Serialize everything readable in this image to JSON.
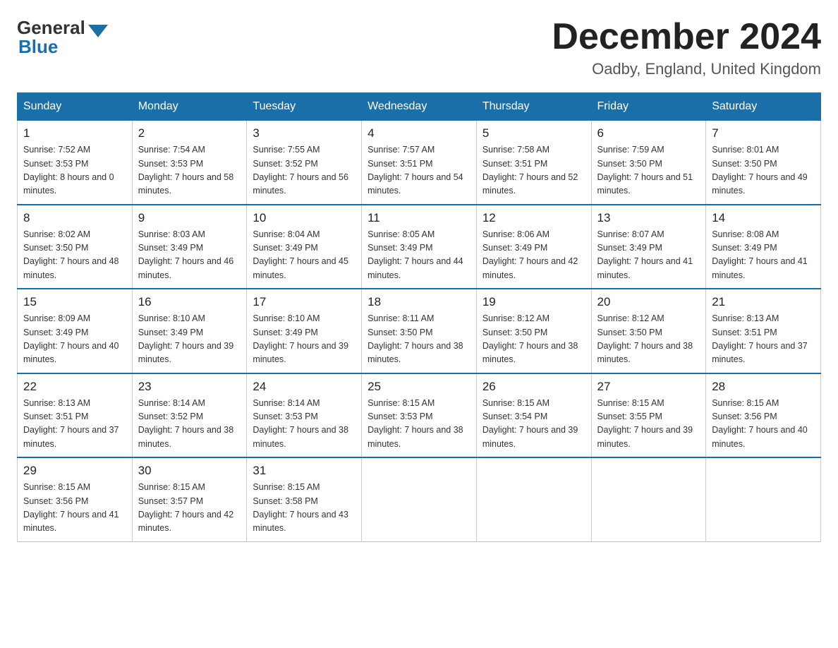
{
  "header": {
    "logo_general": "General",
    "logo_blue": "Blue",
    "month_title": "December 2024",
    "location": "Oadby, England, United Kingdom"
  },
  "days_of_week": [
    "Sunday",
    "Monday",
    "Tuesday",
    "Wednesday",
    "Thursday",
    "Friday",
    "Saturday"
  ],
  "weeks": [
    [
      {
        "date": "1",
        "sunrise": "7:52 AM",
        "sunset": "3:53 PM",
        "daylight": "8 hours and 0 minutes."
      },
      {
        "date": "2",
        "sunrise": "7:54 AM",
        "sunset": "3:53 PM",
        "daylight": "7 hours and 58 minutes."
      },
      {
        "date": "3",
        "sunrise": "7:55 AM",
        "sunset": "3:52 PM",
        "daylight": "7 hours and 56 minutes."
      },
      {
        "date": "4",
        "sunrise": "7:57 AM",
        "sunset": "3:51 PM",
        "daylight": "7 hours and 54 minutes."
      },
      {
        "date": "5",
        "sunrise": "7:58 AM",
        "sunset": "3:51 PM",
        "daylight": "7 hours and 52 minutes."
      },
      {
        "date": "6",
        "sunrise": "7:59 AM",
        "sunset": "3:50 PM",
        "daylight": "7 hours and 51 minutes."
      },
      {
        "date": "7",
        "sunrise": "8:01 AM",
        "sunset": "3:50 PM",
        "daylight": "7 hours and 49 minutes."
      }
    ],
    [
      {
        "date": "8",
        "sunrise": "8:02 AM",
        "sunset": "3:50 PM",
        "daylight": "7 hours and 48 minutes."
      },
      {
        "date": "9",
        "sunrise": "8:03 AM",
        "sunset": "3:49 PM",
        "daylight": "7 hours and 46 minutes."
      },
      {
        "date": "10",
        "sunrise": "8:04 AM",
        "sunset": "3:49 PM",
        "daylight": "7 hours and 45 minutes."
      },
      {
        "date": "11",
        "sunrise": "8:05 AM",
        "sunset": "3:49 PM",
        "daylight": "7 hours and 44 minutes."
      },
      {
        "date": "12",
        "sunrise": "8:06 AM",
        "sunset": "3:49 PM",
        "daylight": "7 hours and 42 minutes."
      },
      {
        "date": "13",
        "sunrise": "8:07 AM",
        "sunset": "3:49 PM",
        "daylight": "7 hours and 41 minutes."
      },
      {
        "date": "14",
        "sunrise": "8:08 AM",
        "sunset": "3:49 PM",
        "daylight": "7 hours and 41 minutes."
      }
    ],
    [
      {
        "date": "15",
        "sunrise": "8:09 AM",
        "sunset": "3:49 PM",
        "daylight": "7 hours and 40 minutes."
      },
      {
        "date": "16",
        "sunrise": "8:10 AM",
        "sunset": "3:49 PM",
        "daylight": "7 hours and 39 minutes."
      },
      {
        "date": "17",
        "sunrise": "8:10 AM",
        "sunset": "3:49 PM",
        "daylight": "7 hours and 39 minutes."
      },
      {
        "date": "18",
        "sunrise": "8:11 AM",
        "sunset": "3:50 PM",
        "daylight": "7 hours and 38 minutes."
      },
      {
        "date": "19",
        "sunrise": "8:12 AM",
        "sunset": "3:50 PM",
        "daylight": "7 hours and 38 minutes."
      },
      {
        "date": "20",
        "sunrise": "8:12 AM",
        "sunset": "3:50 PM",
        "daylight": "7 hours and 38 minutes."
      },
      {
        "date": "21",
        "sunrise": "8:13 AM",
        "sunset": "3:51 PM",
        "daylight": "7 hours and 37 minutes."
      }
    ],
    [
      {
        "date": "22",
        "sunrise": "8:13 AM",
        "sunset": "3:51 PM",
        "daylight": "7 hours and 37 minutes."
      },
      {
        "date": "23",
        "sunrise": "8:14 AM",
        "sunset": "3:52 PM",
        "daylight": "7 hours and 38 minutes."
      },
      {
        "date": "24",
        "sunrise": "8:14 AM",
        "sunset": "3:53 PM",
        "daylight": "7 hours and 38 minutes."
      },
      {
        "date": "25",
        "sunrise": "8:15 AM",
        "sunset": "3:53 PM",
        "daylight": "7 hours and 38 minutes."
      },
      {
        "date": "26",
        "sunrise": "8:15 AM",
        "sunset": "3:54 PM",
        "daylight": "7 hours and 39 minutes."
      },
      {
        "date": "27",
        "sunrise": "8:15 AM",
        "sunset": "3:55 PM",
        "daylight": "7 hours and 39 minutes."
      },
      {
        "date": "28",
        "sunrise": "8:15 AM",
        "sunset": "3:56 PM",
        "daylight": "7 hours and 40 minutes."
      }
    ],
    [
      {
        "date": "29",
        "sunrise": "8:15 AM",
        "sunset": "3:56 PM",
        "daylight": "7 hours and 41 minutes."
      },
      {
        "date": "30",
        "sunrise": "8:15 AM",
        "sunset": "3:57 PM",
        "daylight": "7 hours and 42 minutes."
      },
      {
        "date": "31",
        "sunrise": "8:15 AM",
        "sunset": "3:58 PM",
        "daylight": "7 hours and 43 minutes."
      },
      null,
      null,
      null,
      null
    ]
  ]
}
